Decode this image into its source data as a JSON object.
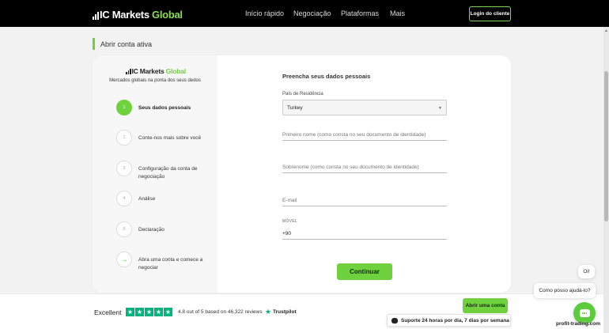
{
  "nav": {
    "brand_prefix": "IC Markets",
    "brand_suffix": " Global",
    "links": [
      "Início rápido",
      "Negociação",
      "Plataformas",
      "Mais"
    ],
    "login_label": "Login do cliente"
  },
  "page": {
    "title": "Abrir conta ativa"
  },
  "card": {
    "brand_prefix": "IC Markets",
    "brand_suffix": " Global",
    "tagline": "Mercados globais na ponta dos seus dedos",
    "steps": [
      {
        "num": "1",
        "label": "Seus dados pessoais",
        "active": true
      },
      {
        "num": "2",
        "label": "Conte-nos mais sobre você"
      },
      {
        "num": "3",
        "label": "Configuração da conta de negociação"
      },
      {
        "num": "4",
        "label": "Análise"
      },
      {
        "num": "5",
        "label": "Declaração"
      },
      {
        "num": "→",
        "label": "Abra uma conta e comece a negociar"
      }
    ]
  },
  "form": {
    "heading": "Preencha seus dados pessoais",
    "country_label": "País de Residência",
    "country_value": "Turkey",
    "first_name_placeholder": "Primeiro nome (como consta no seu documento de identidade)",
    "last_name_placeholder": "Sobrenome (como consta no seu documento de identidade)",
    "email_placeholder": "E-mail",
    "mobile_label": "MÓVEL",
    "mobile_value": "+90",
    "continue_label": "Continuar"
  },
  "footer": {
    "excellent": "Excellent",
    "rating_text": "4.8 out of 5 based on 46,322 reviews",
    "trustpilot": "Trustpilot",
    "open_account_label": "Abrir uma conta",
    "support_text": "Suporte 24 horas por dia, 7 dias por semana"
  },
  "chat": {
    "greeting": "Oi!",
    "prompt": "Como posso ajudá-lo?"
  },
  "watermark": "profit-trading.com",
  "colors": {
    "accent": "#6fd13d",
    "trustpilot": "#00b67a",
    "nav_bg": "#000000"
  }
}
